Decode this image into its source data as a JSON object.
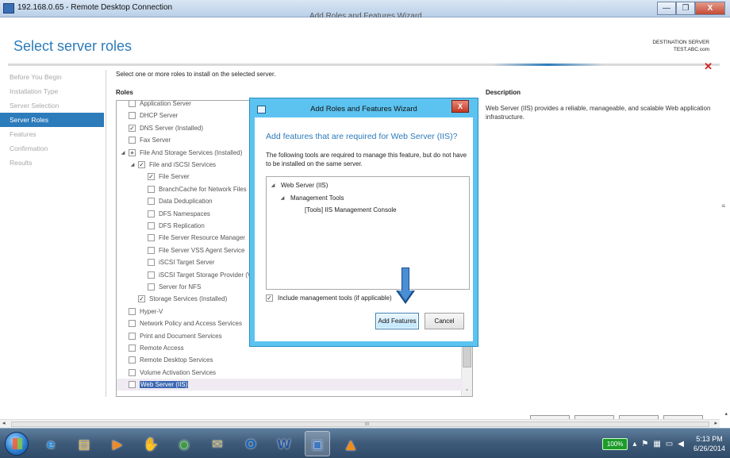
{
  "rdp": {
    "title": "192.168.0.65 - Remote Desktop Connection",
    "background_title": "Add Roles and Features Wizard",
    "minimize": "—",
    "restore": "❐",
    "close": "X"
  },
  "page": {
    "title": "Select server roles",
    "destination_label": "DESTINATION SERVER",
    "destination_server": "TEST.ABC.com",
    "close_glyph": "✕"
  },
  "nav": {
    "items": [
      {
        "label": "Before You Begin",
        "active": false
      },
      {
        "label": "Installation Type",
        "active": false
      },
      {
        "label": "Server Selection",
        "active": false
      },
      {
        "label": "Server Roles",
        "active": true
      },
      {
        "label": "Features",
        "active": false
      },
      {
        "label": "Confirmation",
        "active": false
      },
      {
        "label": "Results",
        "active": false
      }
    ]
  },
  "roles_panel": {
    "instruction": "Select one or more roles to install on the selected server.",
    "heading": "Roles",
    "items": [
      {
        "label": "Application Server",
        "indent": 0,
        "state": "unchecked",
        "expander": ""
      },
      {
        "label": "DHCP Server",
        "indent": 0,
        "state": "unchecked",
        "expander": ""
      },
      {
        "label": "DNS Server (Installed)",
        "indent": 0,
        "state": "checked",
        "expander": ""
      },
      {
        "label": "Fax Server",
        "indent": 0,
        "state": "unchecked",
        "expander": ""
      },
      {
        "label": "File And Storage Services (Installed)",
        "indent": 0,
        "state": "partial",
        "expander": "◢"
      },
      {
        "label": "File and iSCSI Services",
        "indent": 1,
        "state": "checked",
        "expander": "◢"
      },
      {
        "label": "File Server",
        "indent": 2,
        "state": "checked",
        "expander": ""
      },
      {
        "label": "BranchCache for Network Files",
        "indent": 2,
        "state": "unchecked",
        "expander": ""
      },
      {
        "label": "Data Deduplication",
        "indent": 2,
        "state": "unchecked",
        "expander": ""
      },
      {
        "label": "DFS Namespaces",
        "indent": 2,
        "state": "unchecked",
        "expander": ""
      },
      {
        "label": "DFS Replication",
        "indent": 2,
        "state": "unchecked",
        "expander": ""
      },
      {
        "label": "File Server Resource Manager",
        "indent": 2,
        "state": "unchecked",
        "expander": ""
      },
      {
        "label": "File Server VSS Agent Service",
        "indent": 2,
        "state": "unchecked",
        "expander": ""
      },
      {
        "label": "iSCSI Target Server",
        "indent": 2,
        "state": "unchecked",
        "expander": ""
      },
      {
        "label": "iSCSI Target Storage Provider (VD",
        "indent": 2,
        "state": "unchecked",
        "expander": ""
      },
      {
        "label": "Server for NFS",
        "indent": 2,
        "state": "unchecked",
        "expander": ""
      },
      {
        "label": "Storage Services (Installed)",
        "indent": 1,
        "state": "checked",
        "expander": ""
      },
      {
        "label": "Hyper-V",
        "indent": 0,
        "state": "unchecked",
        "expander": ""
      },
      {
        "label": "Network Policy and Access Services",
        "indent": 0,
        "state": "unchecked",
        "expander": ""
      },
      {
        "label": "Print and Document Services",
        "indent": 0,
        "state": "unchecked",
        "expander": ""
      },
      {
        "label": "Remote Access",
        "indent": 0,
        "state": "unchecked",
        "expander": ""
      },
      {
        "label": "Remote Desktop Services",
        "indent": 0,
        "state": "unchecked",
        "expander": ""
      },
      {
        "label": "Volume Activation Services",
        "indent": 0,
        "state": "unchecked",
        "expander": ""
      },
      {
        "label": "Web Server (IIS)",
        "indent": 0,
        "state": "unchecked",
        "expander": "",
        "selected": true
      }
    ],
    "scroll_down": "⌄"
  },
  "description": {
    "heading": "Description",
    "text": "Web Server (IIS) provides a reliable, manageable, and scalable Web application infrastructure."
  },
  "dialog": {
    "title": "Add Roles and Features Wizard",
    "close": "X",
    "heading": "Add features that are required for Web Server (IIS)?",
    "text": "The following tools are required to manage this feature, but do not have to be installed on the same server.",
    "features": [
      {
        "label": "Web Server (IIS)",
        "indent": 0,
        "expander": "◢"
      },
      {
        "label": "Management Tools",
        "indent": 1,
        "expander": "◢"
      },
      {
        "label": "[Tools] IIS Management Console",
        "indent": 2,
        "expander": ""
      }
    ],
    "include_label": "Include management tools (if applicable)",
    "include_checked": "✓",
    "add_button": "Add Features",
    "cancel_button": "Cancel"
  },
  "scrollbar": {
    "left": "◂",
    "right": "▸",
    "grip": "III",
    "up": "▴",
    "side_marker": "≡"
  },
  "taskbar": {
    "apps": [
      {
        "glyph": "e",
        "name": "internet-explorer-icon",
        "color": "#2b8bd8"
      },
      {
        "glyph": "▤",
        "name": "file-explorer-icon",
        "color": "#e8b84a"
      },
      {
        "glyph": "▶",
        "name": "media-player-icon",
        "color": "#f08a24"
      },
      {
        "glyph": "✋",
        "name": "app-hand-icon",
        "color": "#d8342a"
      },
      {
        "glyph": "◉",
        "name": "chrome-icon",
        "color": "#3a9c3f"
      },
      {
        "glyph": "✉",
        "name": "mail-icon",
        "color": "#cdb76a"
      },
      {
        "glyph": "O",
        "name": "outlook-icon",
        "color": "#2067b8"
      },
      {
        "glyph": "W",
        "name": "word-icon",
        "color": "#2b579a"
      },
      {
        "glyph": "▣",
        "name": "remote-desktop-icon",
        "color": "#3f78c0",
        "active": true
      },
      {
        "glyph": "▲",
        "name": "vlc-icon",
        "color": "#f28c1a"
      }
    ],
    "battery": "100%",
    "time": "5:13 PM",
    "date": "6/26/2014"
  }
}
